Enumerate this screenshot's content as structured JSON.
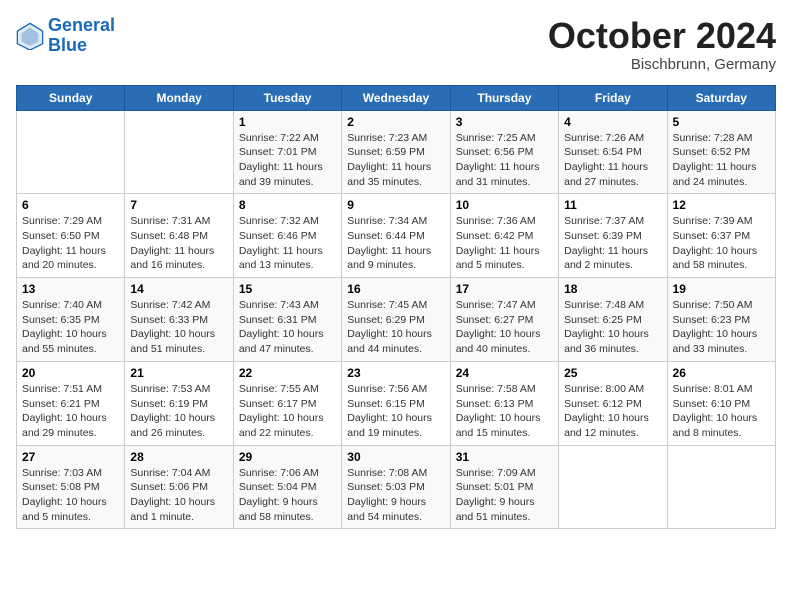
{
  "header": {
    "logo_line1": "General",
    "logo_line2": "Blue",
    "month": "October 2024",
    "location": "Bischbrunn, Germany"
  },
  "weekdays": [
    "Sunday",
    "Monday",
    "Tuesday",
    "Wednesday",
    "Thursday",
    "Friday",
    "Saturday"
  ],
  "weeks": [
    [
      {
        "day": "",
        "info": ""
      },
      {
        "day": "",
        "info": ""
      },
      {
        "day": "1",
        "info": "Sunrise: 7:22 AM\nSunset: 7:01 PM\nDaylight: 11 hours and 39 minutes."
      },
      {
        "day": "2",
        "info": "Sunrise: 7:23 AM\nSunset: 6:59 PM\nDaylight: 11 hours and 35 minutes."
      },
      {
        "day": "3",
        "info": "Sunrise: 7:25 AM\nSunset: 6:56 PM\nDaylight: 11 hours and 31 minutes."
      },
      {
        "day": "4",
        "info": "Sunrise: 7:26 AM\nSunset: 6:54 PM\nDaylight: 11 hours and 27 minutes."
      },
      {
        "day": "5",
        "info": "Sunrise: 7:28 AM\nSunset: 6:52 PM\nDaylight: 11 hours and 24 minutes."
      }
    ],
    [
      {
        "day": "6",
        "info": "Sunrise: 7:29 AM\nSunset: 6:50 PM\nDaylight: 11 hours and 20 minutes."
      },
      {
        "day": "7",
        "info": "Sunrise: 7:31 AM\nSunset: 6:48 PM\nDaylight: 11 hours and 16 minutes."
      },
      {
        "day": "8",
        "info": "Sunrise: 7:32 AM\nSunset: 6:46 PM\nDaylight: 11 hours and 13 minutes."
      },
      {
        "day": "9",
        "info": "Sunrise: 7:34 AM\nSunset: 6:44 PM\nDaylight: 11 hours and 9 minutes."
      },
      {
        "day": "10",
        "info": "Sunrise: 7:36 AM\nSunset: 6:42 PM\nDaylight: 11 hours and 5 minutes."
      },
      {
        "day": "11",
        "info": "Sunrise: 7:37 AM\nSunset: 6:39 PM\nDaylight: 11 hours and 2 minutes."
      },
      {
        "day": "12",
        "info": "Sunrise: 7:39 AM\nSunset: 6:37 PM\nDaylight: 10 hours and 58 minutes."
      }
    ],
    [
      {
        "day": "13",
        "info": "Sunrise: 7:40 AM\nSunset: 6:35 PM\nDaylight: 10 hours and 55 minutes."
      },
      {
        "day": "14",
        "info": "Sunrise: 7:42 AM\nSunset: 6:33 PM\nDaylight: 10 hours and 51 minutes."
      },
      {
        "day": "15",
        "info": "Sunrise: 7:43 AM\nSunset: 6:31 PM\nDaylight: 10 hours and 47 minutes."
      },
      {
        "day": "16",
        "info": "Sunrise: 7:45 AM\nSunset: 6:29 PM\nDaylight: 10 hours and 44 minutes."
      },
      {
        "day": "17",
        "info": "Sunrise: 7:47 AM\nSunset: 6:27 PM\nDaylight: 10 hours and 40 minutes."
      },
      {
        "day": "18",
        "info": "Sunrise: 7:48 AM\nSunset: 6:25 PM\nDaylight: 10 hours and 36 minutes."
      },
      {
        "day": "19",
        "info": "Sunrise: 7:50 AM\nSunset: 6:23 PM\nDaylight: 10 hours and 33 minutes."
      }
    ],
    [
      {
        "day": "20",
        "info": "Sunrise: 7:51 AM\nSunset: 6:21 PM\nDaylight: 10 hours and 29 minutes."
      },
      {
        "day": "21",
        "info": "Sunrise: 7:53 AM\nSunset: 6:19 PM\nDaylight: 10 hours and 26 minutes."
      },
      {
        "day": "22",
        "info": "Sunrise: 7:55 AM\nSunset: 6:17 PM\nDaylight: 10 hours and 22 minutes."
      },
      {
        "day": "23",
        "info": "Sunrise: 7:56 AM\nSunset: 6:15 PM\nDaylight: 10 hours and 19 minutes."
      },
      {
        "day": "24",
        "info": "Sunrise: 7:58 AM\nSunset: 6:13 PM\nDaylight: 10 hours and 15 minutes."
      },
      {
        "day": "25",
        "info": "Sunrise: 8:00 AM\nSunset: 6:12 PM\nDaylight: 10 hours and 12 minutes."
      },
      {
        "day": "26",
        "info": "Sunrise: 8:01 AM\nSunset: 6:10 PM\nDaylight: 10 hours and 8 minutes."
      }
    ],
    [
      {
        "day": "27",
        "info": "Sunrise: 7:03 AM\nSunset: 5:08 PM\nDaylight: 10 hours and 5 minutes."
      },
      {
        "day": "28",
        "info": "Sunrise: 7:04 AM\nSunset: 5:06 PM\nDaylight: 10 hours and 1 minute."
      },
      {
        "day": "29",
        "info": "Sunrise: 7:06 AM\nSunset: 5:04 PM\nDaylight: 9 hours and 58 minutes."
      },
      {
        "day": "30",
        "info": "Sunrise: 7:08 AM\nSunset: 5:03 PM\nDaylight: 9 hours and 54 minutes."
      },
      {
        "day": "31",
        "info": "Sunrise: 7:09 AM\nSunset: 5:01 PM\nDaylight: 9 hours and 51 minutes."
      },
      {
        "day": "",
        "info": ""
      },
      {
        "day": "",
        "info": ""
      }
    ]
  ]
}
